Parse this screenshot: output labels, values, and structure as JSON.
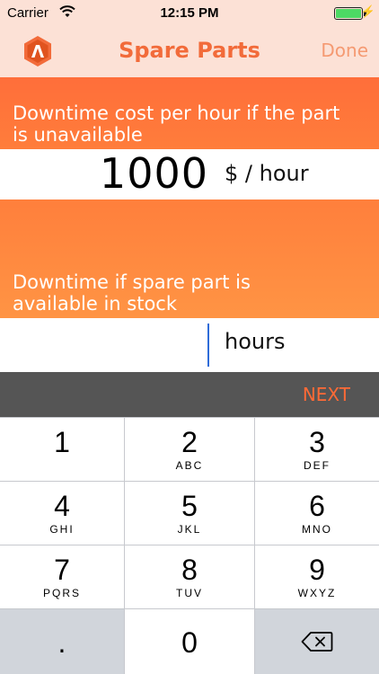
{
  "status_bar": {
    "carrier": "Carrier",
    "time": "12:15 PM"
  },
  "nav": {
    "title": "Spare Parts",
    "done_label": "Done",
    "logo_icon": "logo-icon"
  },
  "downtime_cost": {
    "label": "Downtime cost per hour if the part is unavailable",
    "value": "1000",
    "unit": "$ / hour"
  },
  "downtime_stock": {
    "label": "Downtime if spare part is available in stock",
    "value": "",
    "unit": "hours"
  },
  "toolbar": {
    "next_label": "NEXT"
  },
  "keypad": {
    "keys": [
      {
        "num": "1",
        "letters": ""
      },
      {
        "num": "2",
        "letters": "ABC"
      },
      {
        "num": "3",
        "letters": "DEF"
      },
      {
        "num": "4",
        "letters": "GHI"
      },
      {
        "num": "5",
        "letters": "JKL"
      },
      {
        "num": "6",
        "letters": "MNO"
      },
      {
        "num": "7",
        "letters": "PQRS"
      },
      {
        "num": "8",
        "letters": "TUV"
      },
      {
        "num": "9",
        "letters": "WXYZ"
      },
      {
        "num": ".",
        "letters": ""
      },
      {
        "num": "0",
        "letters": ""
      }
    ],
    "backspace_icon": "backspace-icon"
  },
  "colors": {
    "accent": "#f26b3a",
    "nav_bg": "#fce1d6",
    "section1_bg": "#ff6e3a",
    "section2_bg": "#ff9444",
    "cursor": "#2e6cd8",
    "toolbar_bg": "#555555"
  }
}
